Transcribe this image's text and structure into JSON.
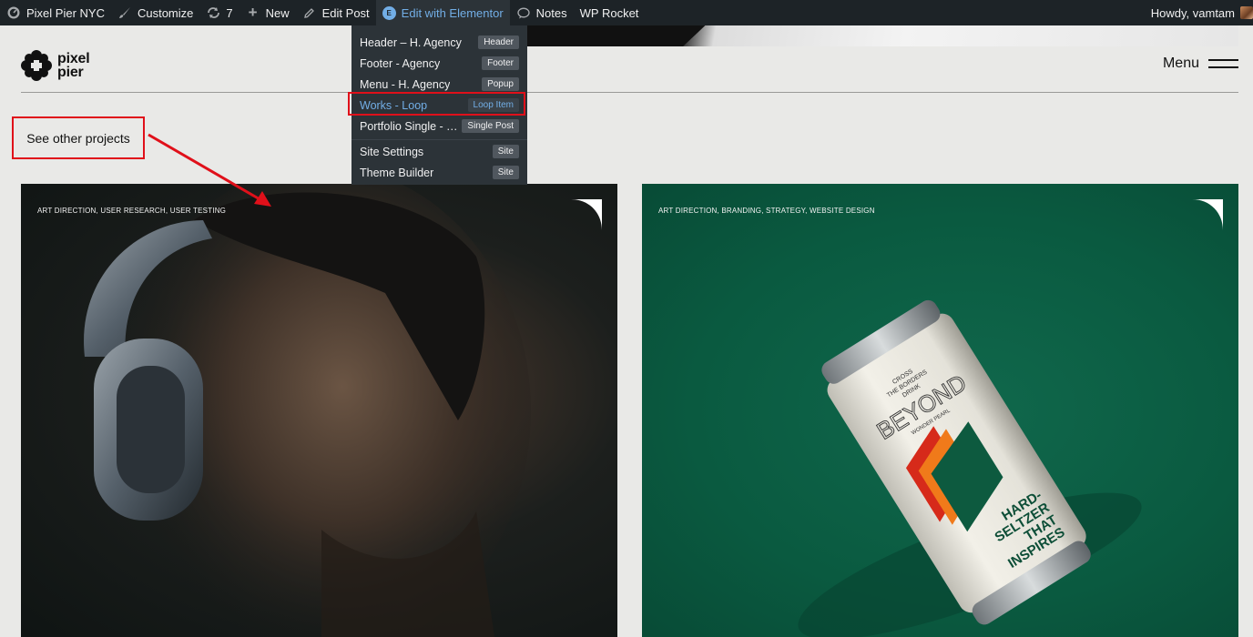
{
  "adminbar": {
    "site_name": "Pixel Pier NYC",
    "customize": "Customize",
    "updates_count": "7",
    "new": "New",
    "edit_post": "Edit Post",
    "edit_elementor": "Edit with Elementor",
    "notes": "Notes",
    "wp_rocket": "WP Rocket",
    "howdy": "Howdy, vamtam"
  },
  "elementor_menu": {
    "items": [
      {
        "name": "Header – H. Agency",
        "tag": "Header"
      },
      {
        "name": "Footer - Agency",
        "tag": "Footer"
      },
      {
        "name": "Menu - H. Agency",
        "tag": "Popup"
      },
      {
        "name": "Works - Loop",
        "tag": "Loop Item"
      },
      {
        "name": "Portfolio Single - Template",
        "tag": "Single Post"
      },
      {
        "name": "Site Settings",
        "tag": "Site"
      },
      {
        "name": "Theme Builder",
        "tag": "Site"
      }
    ]
  },
  "site": {
    "logo_line1": "pixel",
    "logo_line2": "pier",
    "menu_label": "Menu"
  },
  "annotation": {
    "text": "See other projects",
    "color": "#e0101a"
  },
  "cards": [
    {
      "tags": "ART DIRECTION, USER RESEARCH, USER TESTING"
    },
    {
      "tags": "ART DIRECTION, BRANDING, STRATEGY, WEBSITE DESIGN"
    }
  ],
  "can": {
    "line1": "CROSS",
    "line2": "THE BORDERS",
    "line3": "DRINK",
    "brand": "BEYOND",
    "sub": "WONDER PEARL",
    "slogan1": "HARD-",
    "slogan2": "SELTZER",
    "slogan3": "THAT",
    "slogan4": "INSPIRES"
  },
  "colors": {
    "adminbar_bg": "#1d2327",
    "menu_bg": "#2c3338",
    "accent_blue": "#72aee6",
    "page_bg": "#e9e9e7",
    "green_card": "#0a5a40"
  }
}
